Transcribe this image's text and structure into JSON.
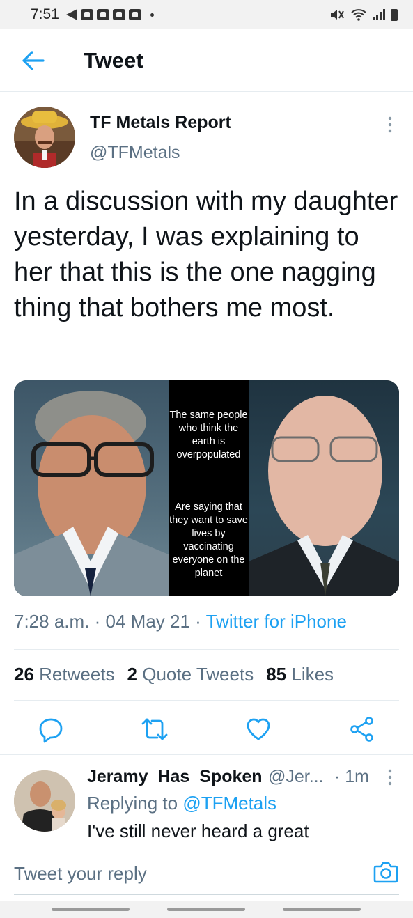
{
  "status_bar": {
    "time": "7:51"
  },
  "header": {
    "title": "Tweet"
  },
  "tweet": {
    "author_name": "TF Metals Report",
    "author_handle": "@TFMetals",
    "text": "In a discussion with my daughter yesterday, I was explaining to her that this is the one nagging thing that bothers me most.",
    "media_caption_top": "The same people who think the earth is overpopulated",
    "media_caption_bottom": "Are saying that they want to save lives by vaccinating everyone on the planet",
    "time": "7:28 a.m.",
    "date": "04 May 21",
    "source": "Twitter for iPhone",
    "retweets_count": "26",
    "retweets_label": "Retweets",
    "quotes_count": "2",
    "quotes_label": "Quote Tweets",
    "likes_count": "85",
    "likes_label": "Likes"
  },
  "reply": {
    "name": "Jeramy_Has_Spoken",
    "handle": "@Jer...",
    "time": "· 1m",
    "replying_prefix": "Replying to",
    "replying_to": "@TFMetals",
    "text": "I've still never heard a great"
  },
  "compose": {
    "placeholder": "Tweet your reply"
  },
  "colors": {
    "accent": "#1da1f2",
    "secondary_text": "#5b7083",
    "primary_text": "#0f1419"
  },
  "icons": [
    "back-arrow-icon",
    "more-vertical-icon",
    "reply-icon",
    "retweet-icon",
    "like-icon",
    "share-icon",
    "camera-icon"
  ]
}
